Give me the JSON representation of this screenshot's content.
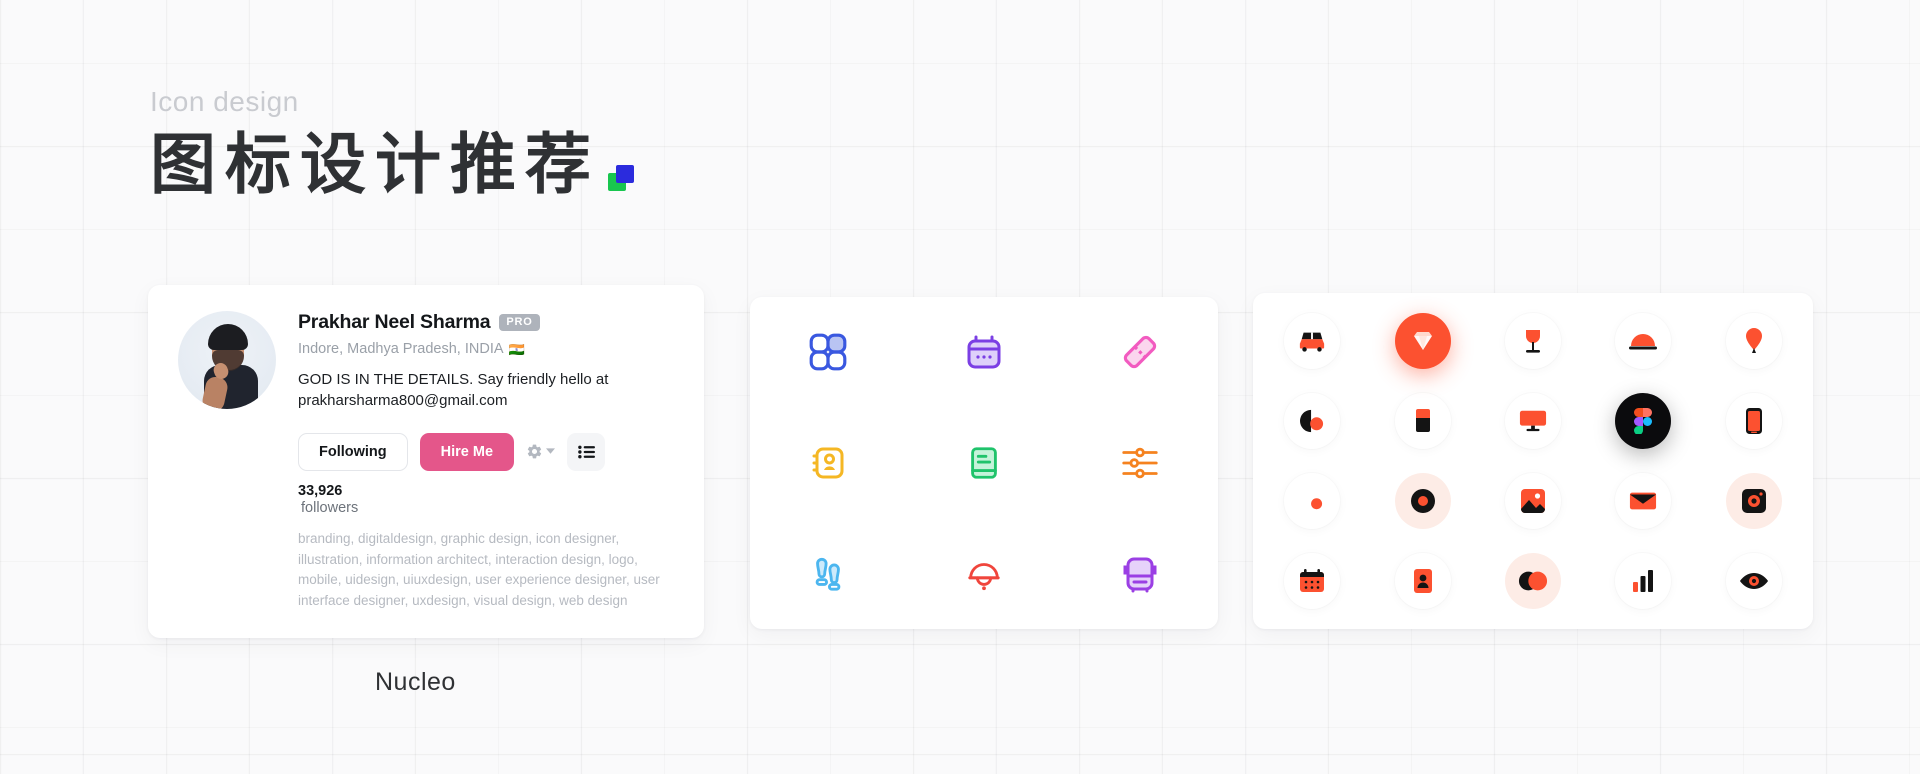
{
  "header": {
    "eyebrow": "Icon design",
    "title_cn": "图标设计推荐",
    "logo_icon": "green-blue-squares-logo"
  },
  "profile": {
    "avatar_icon": "user-avatar-photo",
    "name": "Prakhar Neel Sharma",
    "pro_badge": "PRO",
    "location": "Indore, Madhya Pradesh, INDIA",
    "flag": "🇮🇳",
    "bio": "GOD IS IN THE DETAILS. Say friendly hello at prakharsharma800@gmail.com",
    "buttons": {
      "following": "Following",
      "hire": "Hire Me",
      "gear_icon": "gear-icon",
      "chevron_icon": "chevron-down-icon",
      "list_icon": "list-icon"
    },
    "followers_count": "33,926",
    "followers_label": "followers",
    "tags": "branding, digitaldesign, graphic design, icon designer, illustration, information architect, interaction design, logo, mobile, uidesign, uiuxdesign, user experience designer, user interface designer, uxdesign, visual design, web design"
  },
  "footer": {
    "brand": "Nucleo"
  },
  "colors": {
    "accent_pink": "#e4568a",
    "accent_orange": "#fc5130",
    "ink": "#14171a",
    "muted": "#9aa0a8",
    "tag_gray": "#b6bac1"
  },
  "panel_mid": {
    "icons": [
      {
        "name": "four-circles-grid-icon",
        "color": "#3a58e0"
      },
      {
        "name": "calendar-icon",
        "color": "#7b3fe4"
      },
      {
        "name": "ticket-diamond-icon",
        "color": "#f25bc0"
      },
      {
        "name": "contact-card-icon",
        "color": "#f5b724"
      },
      {
        "name": "book-icon",
        "color": "#1fc36b"
      },
      {
        "name": "sliders-settings-icon",
        "color": "#f5821f"
      },
      {
        "name": "footsteps-icon",
        "color": "#4cb6ef"
      },
      {
        "name": "bell-jellyfish-icon",
        "color": "#f0453c"
      },
      {
        "name": "bus-icon",
        "color": "#9b3fe4"
      }
    ]
  },
  "panel_right": {
    "icons": [
      {
        "name": "car-icon",
        "style": "plain"
      },
      {
        "name": "diamond-gem-icon",
        "style": "solid-orange"
      },
      {
        "name": "wine-glass-icon",
        "style": "plain"
      },
      {
        "name": "food-cloche-icon",
        "style": "plain"
      },
      {
        "name": "pin-pen-icon",
        "style": "plain"
      },
      {
        "name": "contrast-circle-icon",
        "style": "plain"
      },
      {
        "name": "eraser-icon",
        "style": "plain"
      },
      {
        "name": "desktop-monitor-icon",
        "style": "plain"
      },
      {
        "name": "figma-logo-icon",
        "style": "solid-black"
      },
      {
        "name": "smartphone-icon",
        "style": "plain"
      },
      {
        "name": "moon-dot-icon",
        "style": "plain"
      },
      {
        "name": "record-circle-icon",
        "style": "halo-orange"
      },
      {
        "name": "image-photo-icon",
        "style": "plain"
      },
      {
        "name": "envelope-mail-icon",
        "style": "plain"
      },
      {
        "name": "camera-square-icon",
        "style": "halo-orange"
      },
      {
        "name": "calendar-dots-icon",
        "style": "plain"
      },
      {
        "name": "id-badge-icon",
        "style": "plain"
      },
      {
        "name": "overlap-circles-icon",
        "style": "halo-orange"
      },
      {
        "name": "bar-chart-icon",
        "style": "plain"
      },
      {
        "name": "eye-icon",
        "style": "plain"
      }
    ]
  }
}
